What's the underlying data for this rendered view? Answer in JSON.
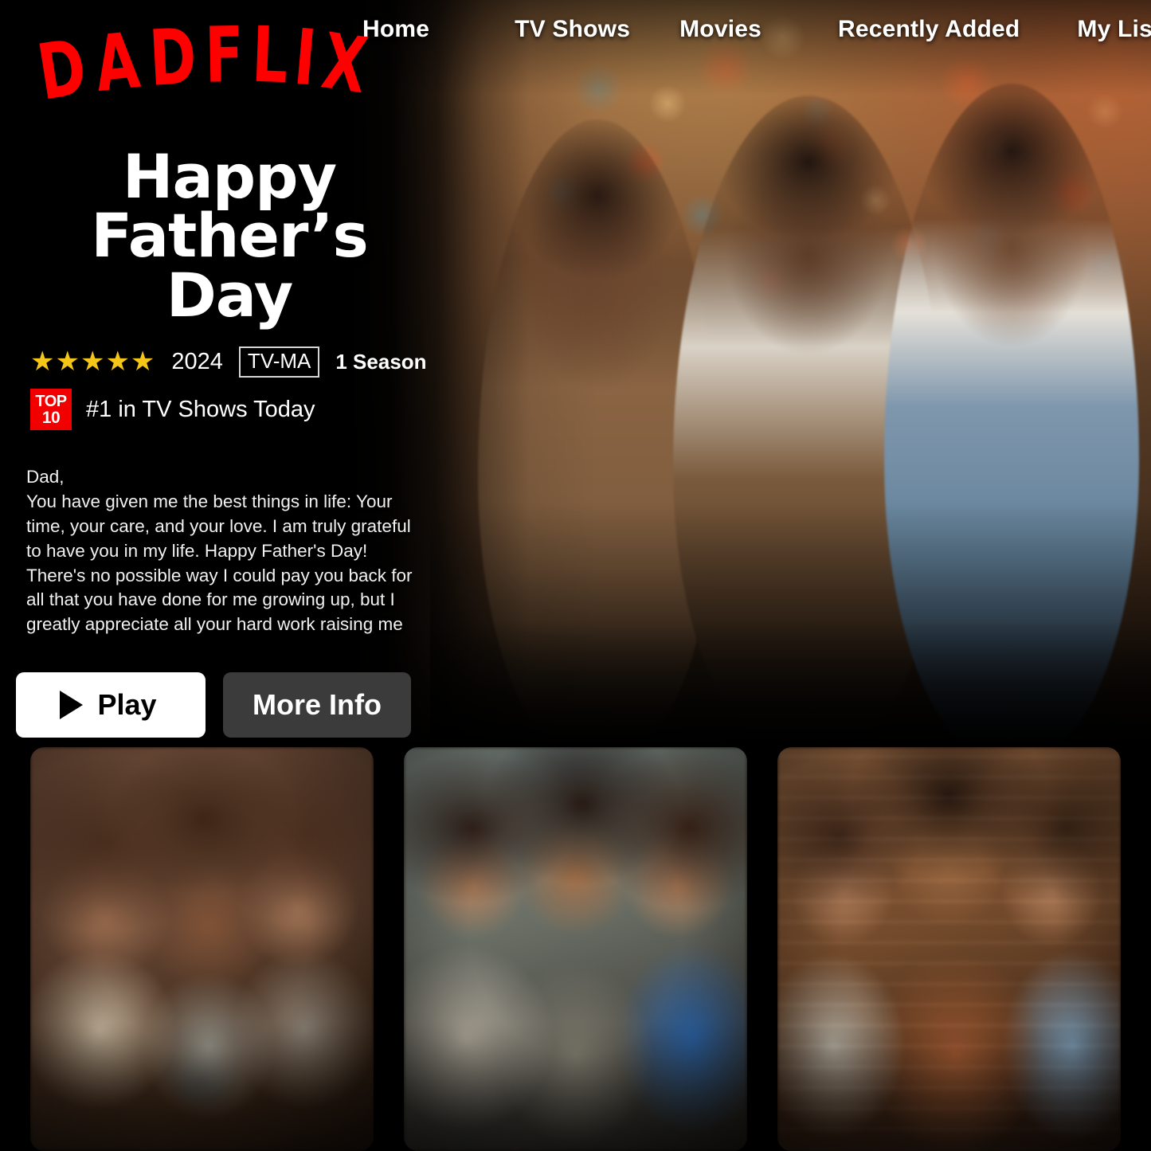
{
  "brand": {
    "logo_text": "DADFLIX",
    "logo_color": "#ff0000",
    "logo_letters": [
      "D",
      "A",
      "D",
      "F",
      "L",
      "I",
      "X"
    ]
  },
  "nav": {
    "items": [
      {
        "label": "Home"
      },
      {
        "label": "TV Shows"
      },
      {
        "label": "Movies"
      },
      {
        "label": "Recently Added"
      },
      {
        "label": "My List"
      }
    ]
  },
  "hero": {
    "title": "Happy Father’s Day",
    "stars": "★★★★★",
    "star_color": "#f5c518",
    "year": "2024",
    "maturity_rating": "TV-MA",
    "seasons": "1 Season",
    "top10": {
      "badge_top": "TOP",
      "badge_bottom": "10",
      "badge_color": "#f20000",
      "text": "#1 in TV Shows Today"
    },
    "description": "Dad,\nYou have given me the best things in life: Your time, your care, and your love. I am truly grateful to have you in my life. Happy Father's Day! There's no possible way I could pay you back for all that you have done for me growing up, but I greatly appreciate all your hard work raising me",
    "buttons": {
      "play_label": "Play",
      "play_icon": "play-triangle-icon",
      "more_info_label": "More Info"
    }
  },
  "thumbnails": [
    {
      "alt": "Father holding a camera with two smiling children in a warm brown studio"
    },
    {
      "alt": "Smiling father with two children holding paintbrushes against a teal-gray backdrop"
    },
    {
      "alt": "Smiling father in a rust shirt with two children holding pencils in front of wood planks"
    }
  ]
}
